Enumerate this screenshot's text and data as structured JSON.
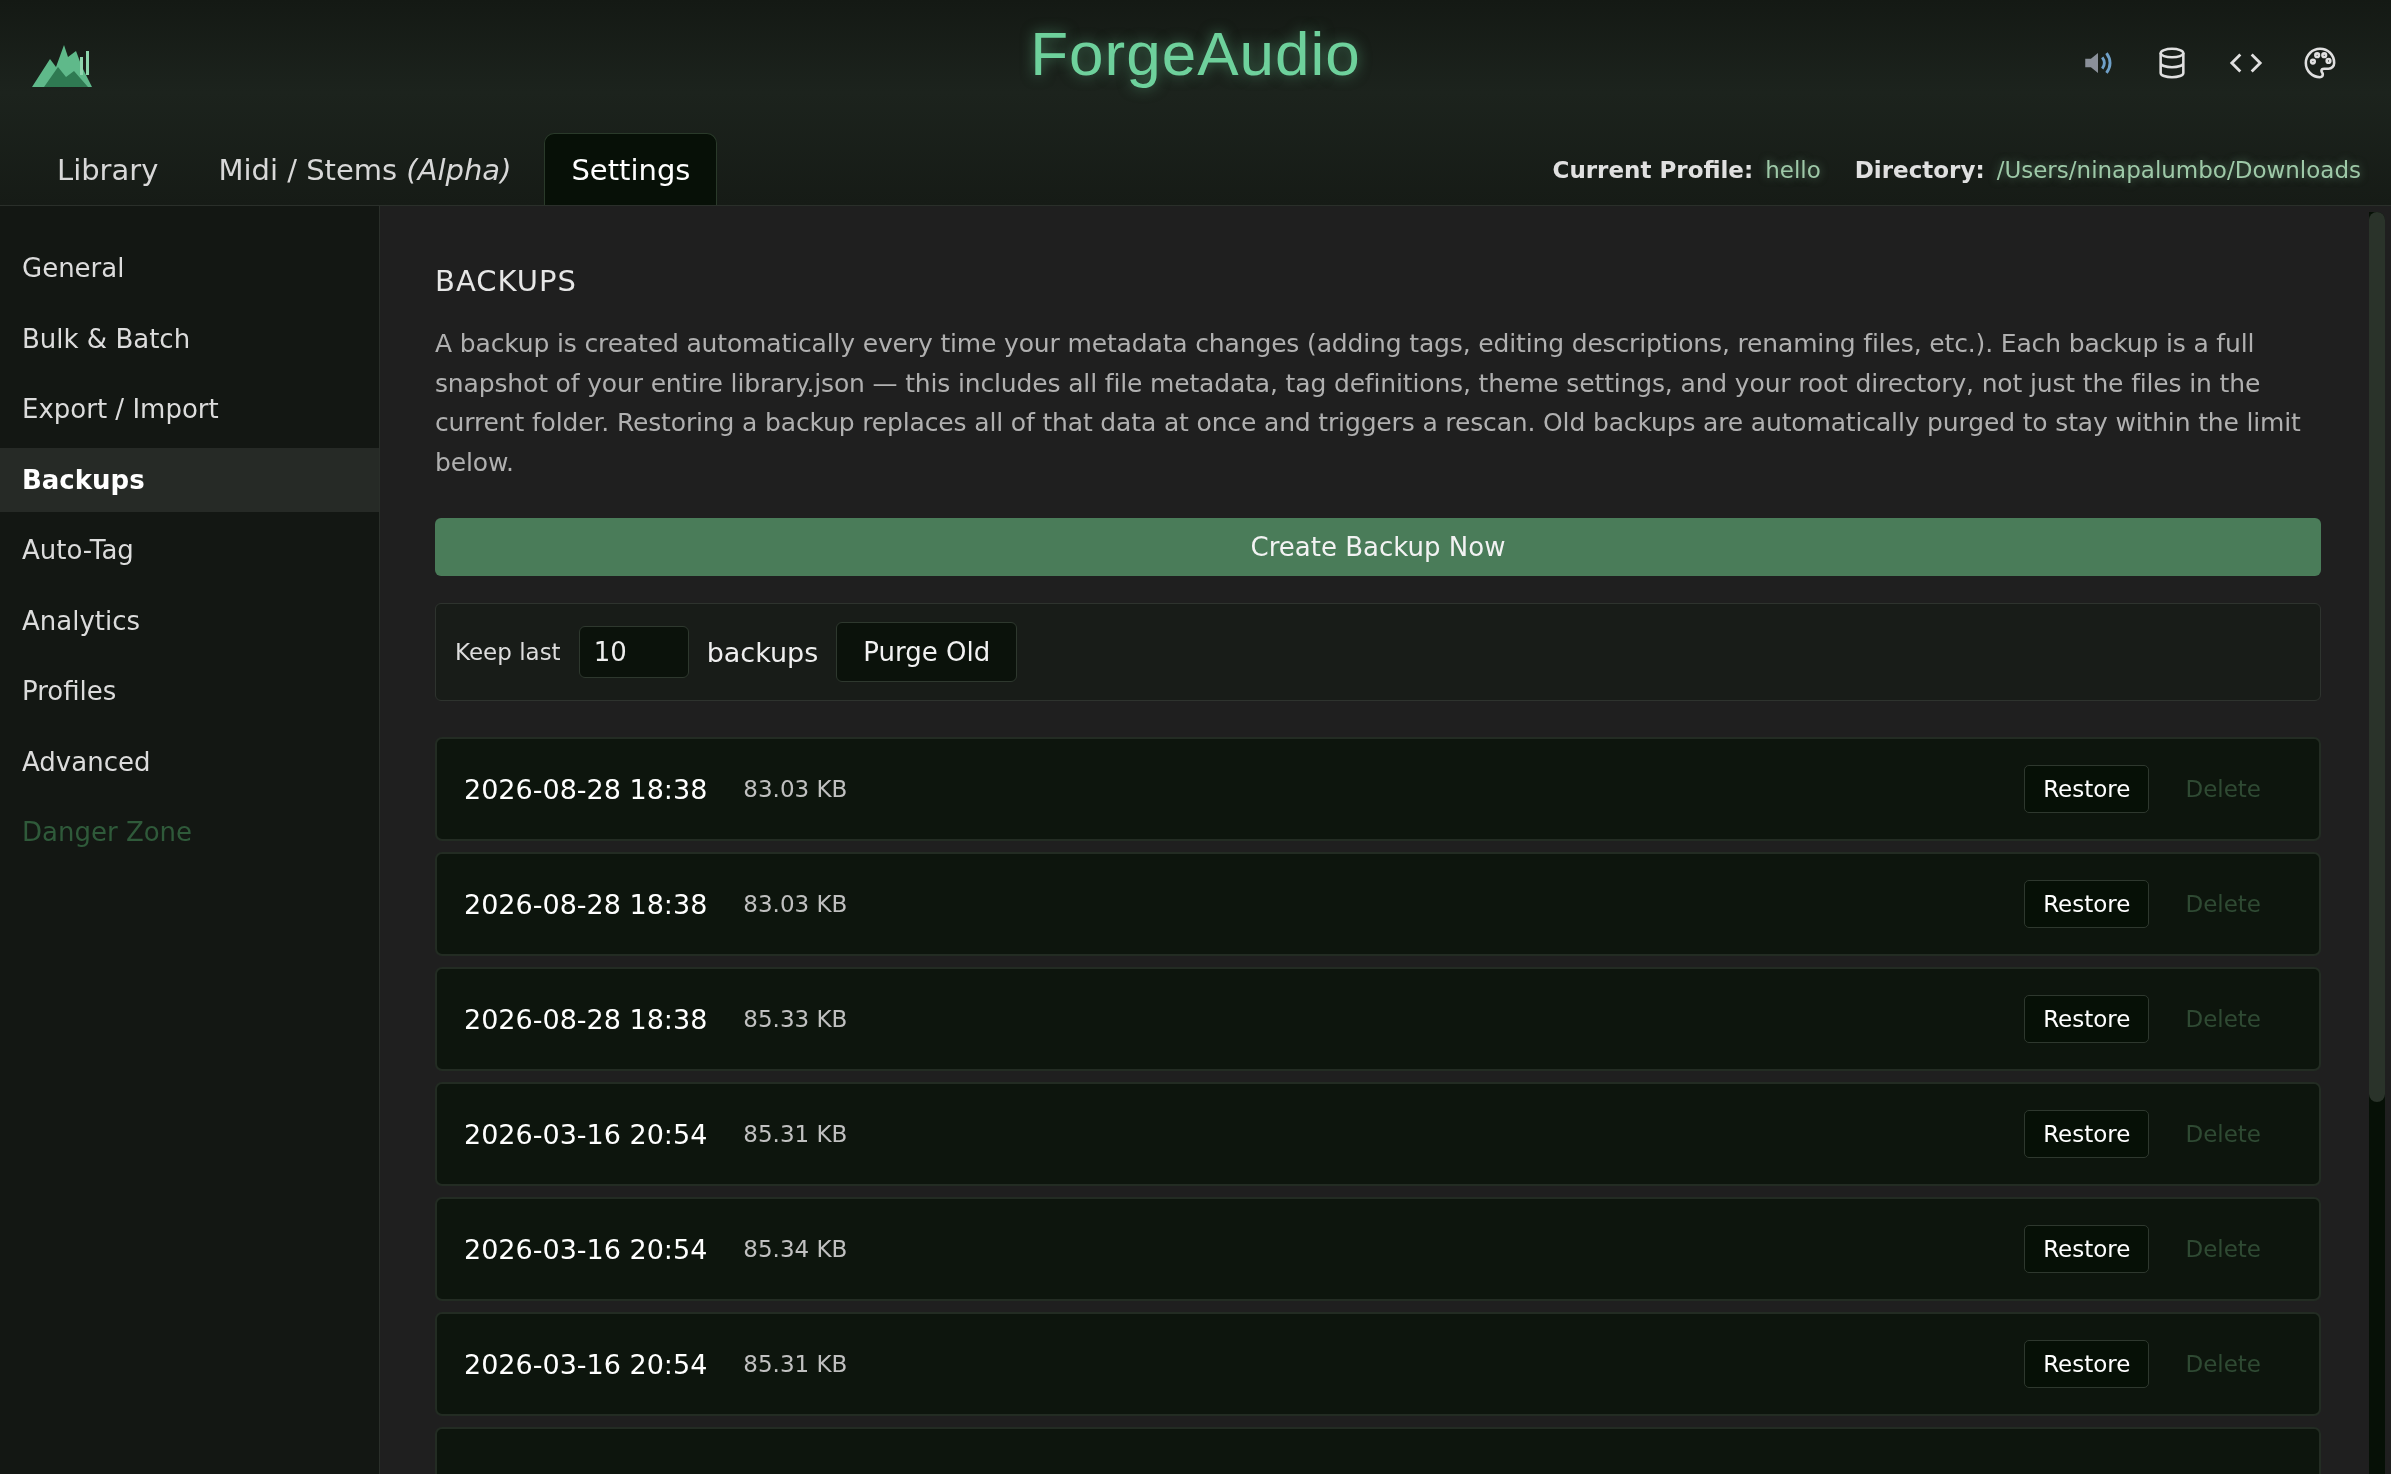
{
  "app": {
    "title": "ForgeAudio"
  },
  "tabs": [
    {
      "label": "Library",
      "selected": false
    },
    {
      "label": "Midi / Stems *(Alpha)*",
      "selected": false
    },
    {
      "label": "Settings",
      "selected": true
    }
  ],
  "profile": {
    "label": "Current Profile:",
    "value": "hello"
  },
  "directory": {
    "label": "Directory:",
    "value": "/Users/ninapalumbo/Downloads"
  },
  "sidebar": {
    "items": [
      {
        "label": "General",
        "selected": false,
        "kind": "normal"
      },
      {
        "label": "Bulk & Batch",
        "selected": false,
        "kind": "normal"
      },
      {
        "label": "Export / Import",
        "selected": false,
        "kind": "normal"
      },
      {
        "label": "Backups",
        "selected": true,
        "kind": "normal"
      },
      {
        "label": "Auto-Tag",
        "selected": false,
        "kind": "normal"
      },
      {
        "label": "Analytics",
        "selected": false,
        "kind": "normal"
      },
      {
        "label": "Profiles",
        "selected": false,
        "kind": "normal"
      },
      {
        "label": "Advanced",
        "selected": false,
        "kind": "normal"
      },
      {
        "label": "Danger Zone",
        "selected": false,
        "kind": "danger"
      }
    ]
  },
  "section": {
    "heading": "BACKUPS",
    "description": "A backup is created automatically every time your metadata changes (adding tags, editing descriptions, renaming files, etc.). Each backup is a full snapshot of your entire library.json — this includes all file metadata, tag definitions, theme settings, and your root directory, not just the files in the current folder. Restoring a backup replaces all of that data at once and triggers a rescan. Old backups are automatically purged to stay within the limit below.",
    "create_button": "Create Backup Now",
    "keep": {
      "label": "Keep last",
      "value": "10",
      "suffix": "backups",
      "button": "Purge Old"
    },
    "backups": [
      {
        "date": "2026-08-28 18:38",
        "size": "83.03 KB",
        "restore": "Restore",
        "delete": "Delete",
        "delete_disabled": true
      },
      {
        "date": "2026-08-28 18:38",
        "size": "83.03 KB",
        "restore": "Restore",
        "delete": "Delete",
        "delete_disabled": true
      },
      {
        "date": "2026-08-28 18:38",
        "size": "85.33 KB",
        "restore": "Restore",
        "delete": "Delete",
        "delete_disabled": true
      },
      {
        "date": "2026-03-16 20:54",
        "size": "85.31 KB",
        "restore": "Restore",
        "delete": "Delete",
        "delete_disabled": true
      },
      {
        "date": "2026-03-16 20:54",
        "size": "85.34 KB",
        "restore": "Restore",
        "delete": "Delete",
        "delete_disabled": true
      },
      {
        "date": "2026-03-16 20:54",
        "size": "85.31 KB",
        "restore": "Restore",
        "delete": "Delete",
        "delete_disabled": true
      }
    ]
  }
}
